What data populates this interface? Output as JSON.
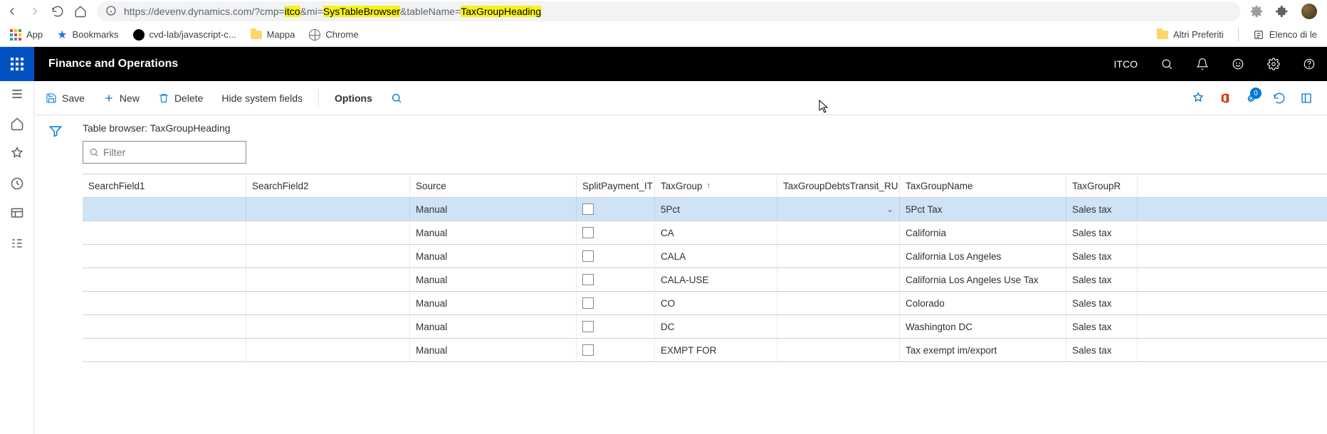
{
  "browser": {
    "url_prefix": "https://devenv.dynamics.com/?cmp=",
    "url_cmp": "itco",
    "url_mid1": "&mi=",
    "url_mi": "SysTableBrowser",
    "url_mid2": "&tableName=",
    "url_table": "TaxGroupHeading",
    "bookmarks": {
      "apps": "App",
      "bookmarks": "Bookmarks",
      "repo": "cvd-lab/javascript-c...",
      "mappa": "Mappa",
      "chrome": "Chrome",
      "altri": "Altri Preferiti",
      "elenco": "Elenco di le"
    }
  },
  "header": {
    "app_title": "Finance and Operations",
    "company": "ITCO"
  },
  "action_bar": {
    "save": "Save",
    "new": "New",
    "delete": "Delete",
    "hide": "Hide system fields",
    "options": "Options",
    "badge": "0"
  },
  "page": {
    "title": "Table browser: TaxGroupHeading",
    "filter_placeholder": "Filter"
  },
  "columns": {
    "sf1": "SearchField1",
    "sf2": "SearchField2",
    "source": "Source",
    "split": "SplitPayment_IT",
    "taxgroup": "TaxGroup",
    "debts": "TaxGroupDebtsTransit_RU",
    "name": "TaxGroupName",
    "rounding": "TaxGroupR"
  },
  "rows": [
    {
      "source": "Manual",
      "split": false,
      "taxgroup": "5Pct",
      "debts": "",
      "name": "5Pct Tax",
      "rounding": "Sales tax"
    },
    {
      "source": "Manual",
      "split": false,
      "taxgroup": "CA",
      "debts": "",
      "name": "California",
      "rounding": "Sales tax"
    },
    {
      "source": "Manual",
      "split": false,
      "taxgroup": "CALA",
      "debts": "",
      "name": "California Los Angeles",
      "rounding": "Sales tax"
    },
    {
      "source": "Manual",
      "split": false,
      "taxgroup": "CALA-USE",
      "debts": "",
      "name": "California  Los Angeles Use Tax",
      "rounding": "Sales tax"
    },
    {
      "source": "Manual",
      "split": false,
      "taxgroup": "CO",
      "debts": "",
      "name": "Colorado",
      "rounding": "Sales tax"
    },
    {
      "source": "Manual",
      "split": false,
      "taxgroup": "DC",
      "debts": "",
      "name": "Washington DC",
      "rounding": "Sales tax"
    },
    {
      "source": "Manual",
      "split": false,
      "taxgroup": "EXMPT FOR",
      "debts": "",
      "name": "Tax exempt im/export",
      "rounding": "Sales tax"
    }
  ]
}
